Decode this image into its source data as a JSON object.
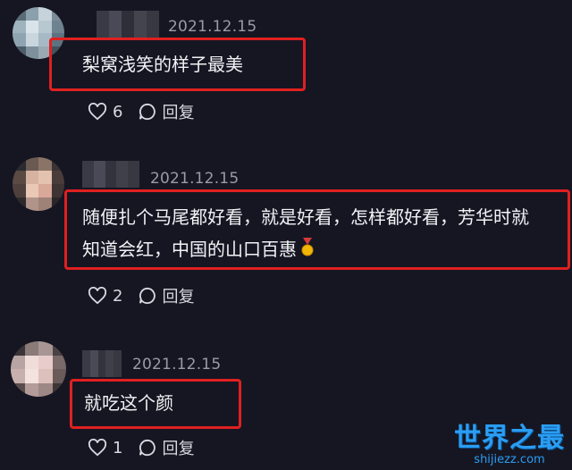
{
  "comments": [
    {
      "date": "2021.12.15",
      "text_lines": [
        "梨窝浅笑的样子最美"
      ],
      "likes": "6",
      "reply_label": "回复"
    },
    {
      "date": "2021.12.15",
      "text_lines": [
        "随便扎个马尾都好看，就是好看，怎样都好看，芳华时就",
        "知道会红，中国的山口百惠"
      ],
      "likes": "2",
      "reply_label": "回复"
    },
    {
      "date": "2021.12.15",
      "text_lines": [
        "就吃这个颜"
      ],
      "likes": "1",
      "reply_label": "回复"
    }
  ],
  "watermark": {
    "brand": "世界之最",
    "url": "shijiezz.com"
  },
  "colors": {
    "background": "#161622",
    "highlight_border": "#e02020",
    "watermark": "#2a9df4"
  }
}
